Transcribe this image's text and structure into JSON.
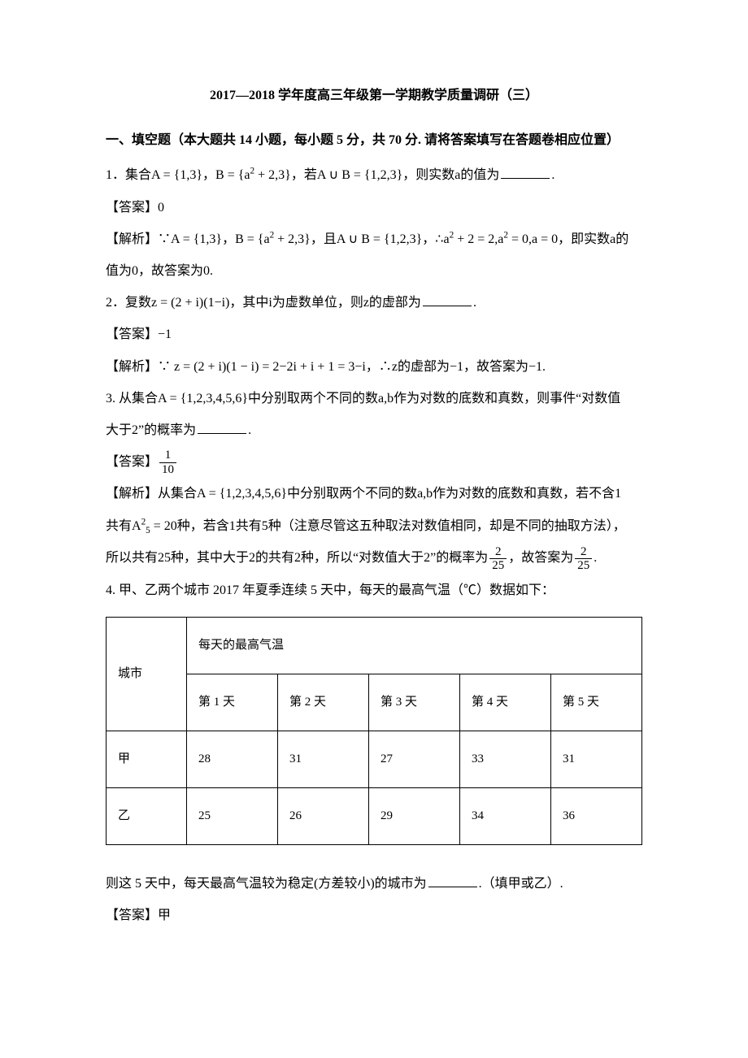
{
  "title": "2017—2018 学年度高三年级第一学期教学质量调研（三）",
  "section_heading": "一、填空题（本大题共 14 小题，每小题 5 分，共 70 分. 请将答案填写在答题卷相应位置）",
  "q1": {
    "prefix": "1．集合A = {1,3}，B = {a",
    "mid1": " + 2,3}，若A ∪ B = {1,2,3}，则实数a的值为",
    "suffix": "."
  },
  "a1_label": "【答案】",
  "a1_value": "0",
  "e1": {
    "label": "【解析】",
    "t1": "∵A = {1,3}，B = {a",
    "t2": " + 2,3}，且A ∪ B = {1,2,3}，∴a",
    "t3": " + 2 = 2,a",
    "t4": " = 0,a = 0，即实数a的",
    "t5": "值为0，故答案为0."
  },
  "q2": {
    "prefix": "2．复数z = (2 + i)(1−i)，其中i为虚数单位，则z的虚部为",
    "suffix": "."
  },
  "a2_label": "【答案】",
  "a2_value": "−1",
  "e2": {
    "label": "【解析】",
    "t": "∵ z = (2 + i)(1 − i)  = 2−2i + i + 1 = 3−i，∴z的虚部为−1，故答案为−1."
  },
  "q3": {
    "t1": "3. 从集合A = {1,2,3,4,5,6}中分别取两个不同的数a,b作为对数的底数和真数，则事件“对数值",
    "t2": "大于2”的概率为",
    "suffix": "."
  },
  "a3_label": "【答案】",
  "a3_frac_num": "1",
  "a3_frac_den": "10",
  "e3": {
    "label": "【解析】",
    "t1": "从集合A = {1,2,3,4,5,6}中分别取两个不同的数a,b作为对数的底数和真数，若不含1",
    "t2a": "共有A",
    "t2b": " = 20种，若含1共有5种（注意尽管这五种取法对数值相同，却是不同的抽取方法），",
    "t3a": "所以共有25种，其中大于2的共有2种，所以“对数值大于2”的概率为",
    "t3b": "，故答案为",
    "t3c": ".",
    "frac_num": "2",
    "frac_den": "25",
    "perm_upper": "2",
    "perm_lower": "5"
  },
  "q4": {
    "intro": "4. 甲、乙两个城市 2017 年夏季连续 5 天中，每天的最高气温（℃）数据如下：",
    "outro_a": "则这 5 天中，每天最高气温较为稳定(方差较小)的城市为",
    "outro_b": ".（填甲或乙）."
  },
  "a4_label": "【答案】",
  "a4_value": "甲",
  "table": {
    "row_header": "城市",
    "col_group": "每天的最高气温",
    "days": [
      "第 1 天",
      "第 2 天",
      "第 3 天",
      "第 4 天",
      "第 5 天"
    ],
    "rows": [
      {
        "city": "甲",
        "vals": [
          "28",
          "31",
          "27",
          "33",
          "31"
        ]
      },
      {
        "city": "乙",
        "vals": [
          "25",
          "26",
          "29",
          "34",
          "36"
        ]
      }
    ]
  },
  "chart_data": {
    "type": "table",
    "title": "每天的最高气温（℃）",
    "categories": [
      "第 1 天",
      "第 2 天",
      "第 3 天",
      "第 4 天",
      "第 5 天"
    ],
    "series": [
      {
        "name": "甲",
        "values": [
          28,
          31,
          27,
          33,
          31
        ]
      },
      {
        "name": "乙",
        "values": [
          25,
          26,
          29,
          34,
          36
        ]
      }
    ]
  }
}
